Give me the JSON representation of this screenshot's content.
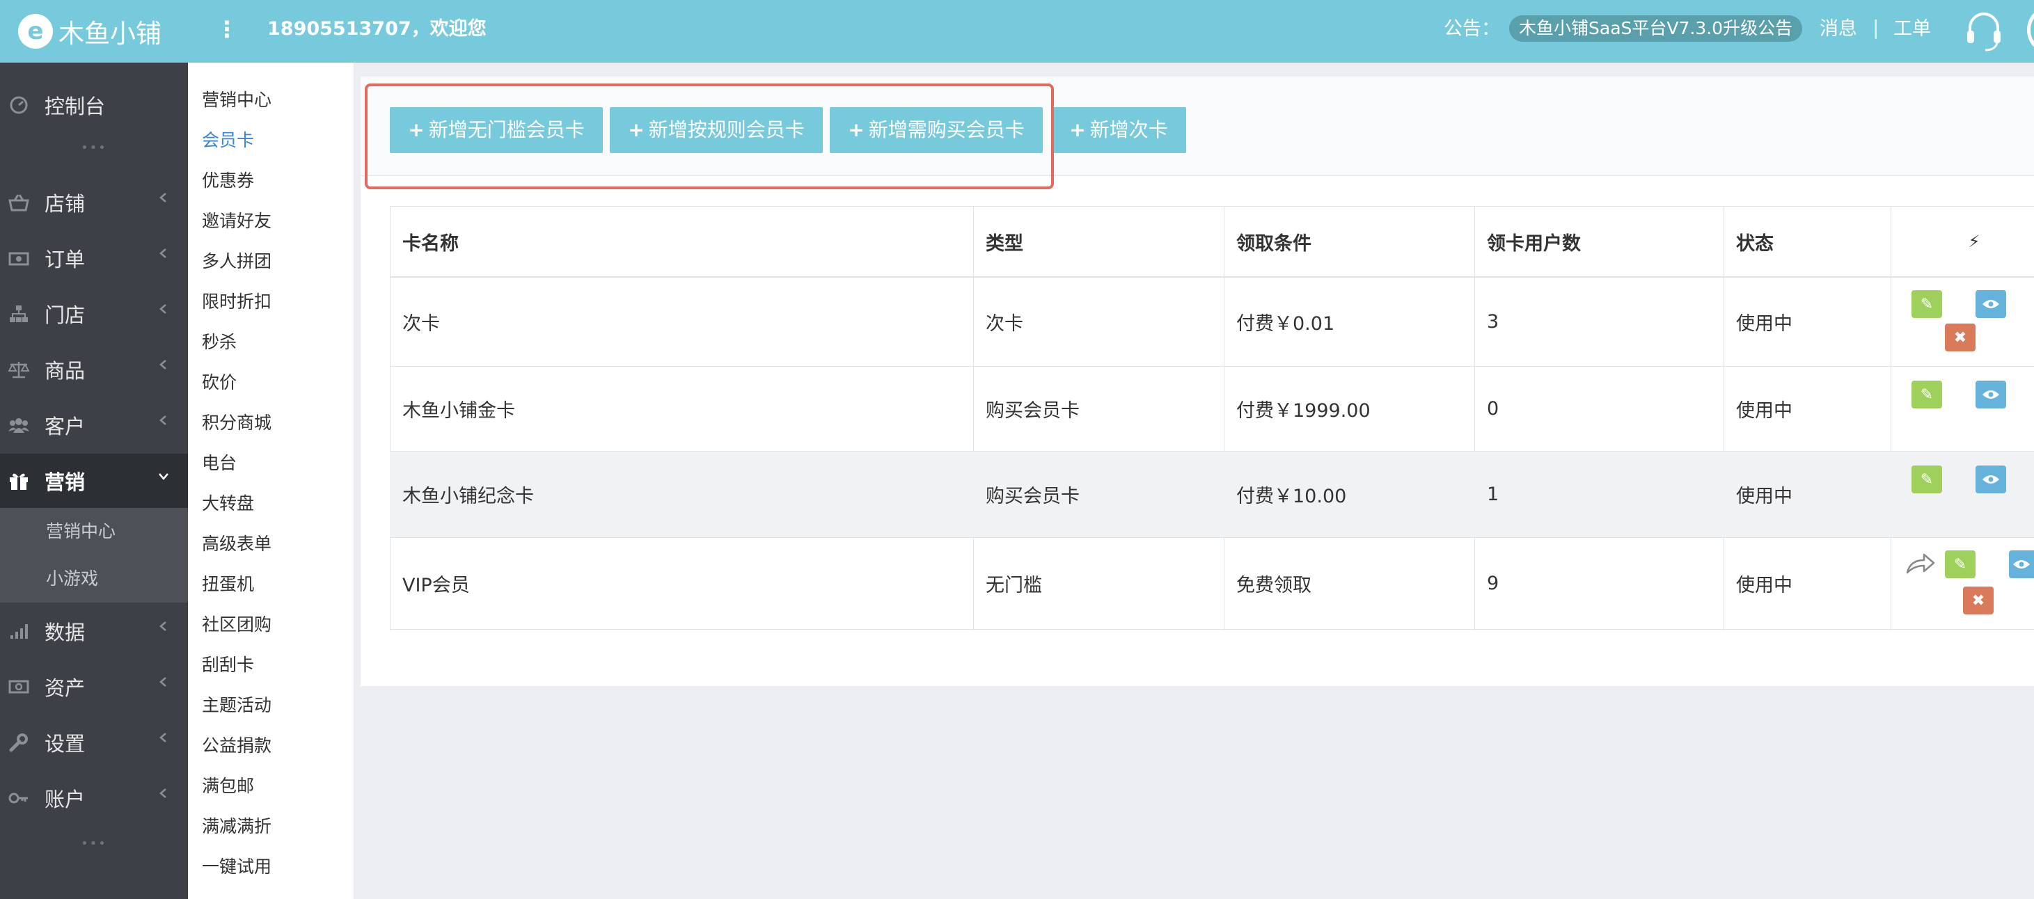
{
  "header": {
    "logo_mark": "e",
    "logo_text": "木鱼小铺",
    "menu_dots": "⋮",
    "welcome": "18905513707，欢迎您",
    "notice_label": "公告：",
    "notice_text": "木鱼小铺SaaS平台V7.3.0升级公告",
    "messages": "消息",
    "separator": "|",
    "tickets": "工单"
  },
  "sidebar": {
    "items": [
      {
        "label": "控制台",
        "icon": "dashboard-icon"
      },
      {
        "label": "店铺",
        "icon": "basket-icon"
      },
      {
        "label": "订单",
        "icon": "money-icon"
      },
      {
        "label": "门店",
        "icon": "sitemap-icon"
      },
      {
        "label": "商品",
        "icon": "scale-icon"
      },
      {
        "label": "客户",
        "icon": "users-icon"
      },
      {
        "label": "营销",
        "icon": "gift-icon"
      },
      {
        "label": "数据",
        "icon": "signal-icon"
      },
      {
        "label": "资产",
        "icon": "cash-icon"
      },
      {
        "label": "设置",
        "icon": "wrench-icon"
      },
      {
        "label": "账户",
        "icon": "key-icon"
      }
    ],
    "sub_items": [
      "营销中心",
      "小游戏"
    ],
    "dots": "•••"
  },
  "submenu": {
    "items": [
      "营销中心",
      "会员卡",
      "优惠券",
      "邀请好友",
      "多人拼团",
      "限时折扣",
      "秒杀",
      "砍价",
      "积分商城",
      "电台",
      "大转盘",
      "高级表单",
      "扭蛋机",
      "社区团购",
      "刮刮卡",
      "主题活动",
      "公益捐款",
      "满包邮",
      "满减满折",
      "一键试用"
    ],
    "active": "会员卡"
  },
  "buttons": {
    "plus": "+",
    "add_free": "新增无门槛会员卡",
    "add_rule": "新增按规则会员卡",
    "add_purchase": "新增需购买会员卡",
    "add_count": "新增次卡"
  },
  "table": {
    "headers": [
      "卡名称",
      "类型",
      "领取条件",
      "领卡用户数",
      "状态"
    ],
    "action_header_icon": "bolt-icon",
    "rows": [
      {
        "name": "次卡",
        "type": "次卡",
        "condition": "付费￥0.01",
        "users": "3",
        "status": "使用中"
      },
      {
        "name": "木鱼小铺金卡",
        "type": "购买会员卡",
        "condition": "付费￥1999.00",
        "users": "0",
        "status": "使用中"
      },
      {
        "name": "木鱼小铺纪念卡",
        "type": "购买会员卡",
        "condition": "付费￥10.00",
        "users": "1",
        "status": "使用中"
      },
      {
        "name": "VIP会员",
        "type": "无门槛",
        "condition": "免费领取",
        "users": "9",
        "status": "使用中"
      }
    ],
    "icons": {
      "edit": "pencil-icon",
      "view": "eye-icon",
      "delete": "close-icon",
      "share": "share-icon"
    },
    "glyphs": {
      "edit": "✎",
      "delete": "✖",
      "bolt": "⚡"
    }
  },
  "colors": {
    "header": "#77cadc",
    "sidebar": "#3d4046",
    "button": "#77cadc",
    "highlight_frame": "#e26a5f",
    "edit": "#9fd05c",
    "view": "#65b3dc",
    "delete": "#d97b5a",
    "active_link": "#3a86d4"
  }
}
